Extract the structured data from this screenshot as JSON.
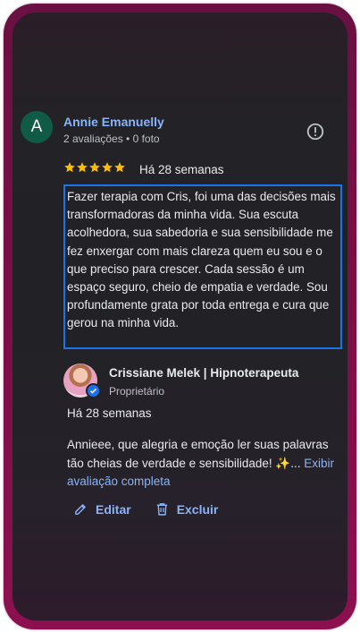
{
  "review": {
    "avatar_letter": "A",
    "reviewer_name": "Annie Emanuelly",
    "reviewer_meta": "2 avaliações • 0 foto",
    "rating": 5,
    "date": "Há 28 semanas",
    "text": "Fazer terapia com Cris, foi uma das decisões mais transformadoras da minha vida. Sua escuta acolhedora, sua sabedoria e sua sensibilidade me fez enxergar com mais clareza quem eu sou e o que preciso para crescer. Cada sessão é um espaço seguro, cheio de empatia e verdade. Sou profundamente grata por toda entrega e cura que gerou na minha vida."
  },
  "reply": {
    "owner_name": "Crissiane Melek | Hipnoterapeuta",
    "owner_role": "Proprietário",
    "date": "Há 28 semanas",
    "text": "Annieee, que alegria e emoção ler suas palavras tão cheias de verdade e sensibilidade! ✨...",
    "show_more_label": "Exibir avaliação completa"
  },
  "actions": {
    "edit_label": "Editar",
    "delete_label": "Excluir"
  },
  "colors": {
    "accent": "#8ab4f8",
    "star": "#fbbc04",
    "frame": "#7a0f47",
    "highlight_border": "#1a73e8"
  }
}
